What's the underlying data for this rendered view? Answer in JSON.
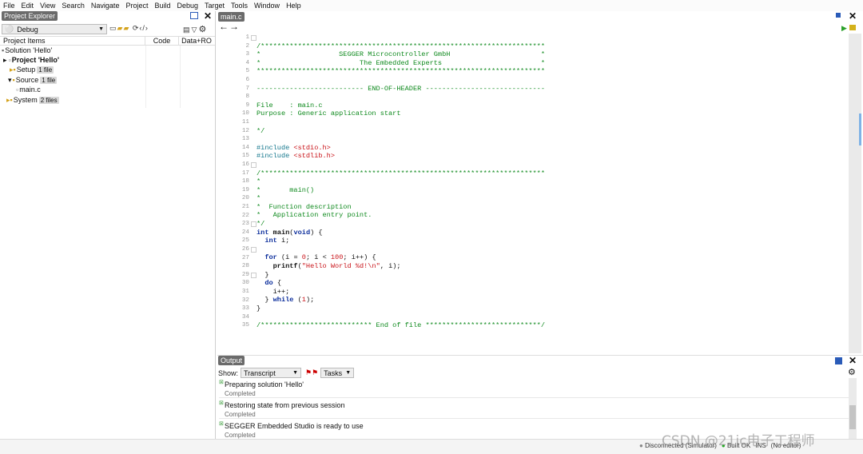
{
  "menu": [
    "File",
    "Edit",
    "View",
    "Search",
    "Navigate",
    "Project",
    "Build",
    "Debug",
    "Target",
    "Tools",
    "Window",
    "Help"
  ],
  "project_explorer": {
    "title": "Project Explorer",
    "config": "Debug",
    "columns": {
      "items": "Project Items",
      "code": "Code",
      "data": "Data+RO"
    },
    "tree": [
      {
        "label": "Solution 'Hello'",
        "count": ""
      },
      {
        "label": "Project 'Hello'",
        "count": ""
      },
      {
        "label": "Setup",
        "count": "1 file"
      },
      {
        "label": "Source",
        "count": "1 file"
      },
      {
        "label": "main.c",
        "count": ""
      },
      {
        "label": "System",
        "count": "2 files"
      }
    ]
  },
  "editor": {
    "tab": "main.c",
    "line_numbers": [
      "1",
      "2",
      "3",
      "4",
      "5",
      "6",
      "7",
      "8",
      "9",
      "10",
      "11",
      "12",
      "13",
      "14",
      "15",
      "16",
      "17",
      "18",
      "19",
      "20",
      "21",
      "22",
      "23",
      "24",
      "25",
      "26",
      "27",
      "28",
      "29",
      "30",
      "31",
      "32",
      "33",
      "34",
      "35"
    ]
  },
  "output": {
    "title": "Output",
    "show_label": "Show:",
    "show_value": "Transcript",
    "tasks_value": "Tasks",
    "rows": [
      {
        "title": "Preparing solution 'Hello'",
        "status": "Completed"
      },
      {
        "title": "Restoring state from previous session",
        "status": "Completed"
      },
      {
        "title": "SEGGER Embedded Studio is ready to use",
        "status": "Completed"
      }
    ]
  },
  "status": {
    "connection": "Disconnected (Simulator)",
    "build": "Built OK",
    "mode": "INS",
    "editor": "(No editor)"
  },
  "watermark": "CSDN @21ic电子工程师"
}
